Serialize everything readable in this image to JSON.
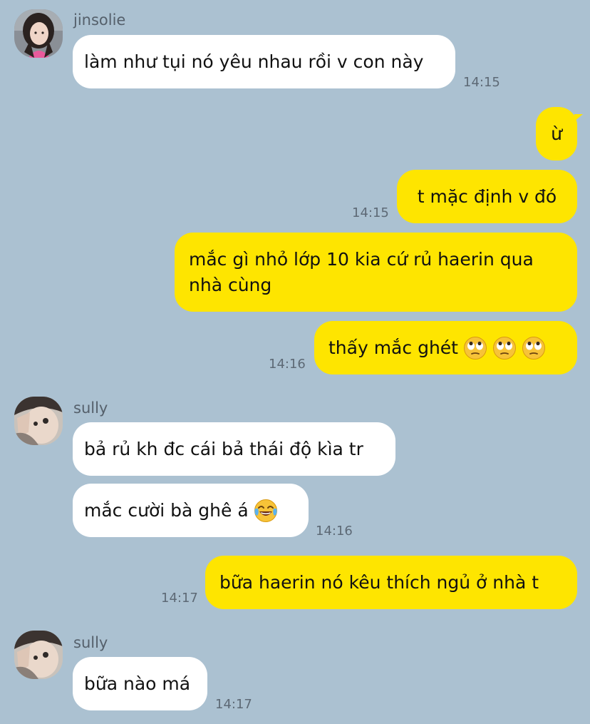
{
  "colors": {
    "background": "#abc1d1",
    "incoming_bubble": "#ffffff",
    "outgoing_bubble": "#fee500",
    "timestamp": "#5d6975"
  },
  "messages": [
    {
      "sender": "jinsolie",
      "text": "làm như tụi nó yêu nhau rồi v con này",
      "time": "14:15"
    },
    {
      "text": "ừ"
    },
    {
      "text": "t mặc định v đó",
      "time": "14:15"
    },
    {
      "text": "mắc gì nhỏ lớp 10 kia cứ rủ haerin qua nhà cùng"
    },
    {
      "text": "thấy mắc ghét",
      "emoji": [
        "face-with-rolling-eyes-icon",
        "face-with-rolling-eyes-icon",
        "face-with-rolling-eyes-icon"
      ],
      "time": "14:16"
    },
    {
      "sender": "sully",
      "text": "bả rủ kh đc cái bả thái độ kìa tr"
    },
    {
      "text": "mắc cười bà ghê á",
      "emoji": [
        "face-with-tears-of-joy-icon"
      ],
      "time": "14:16"
    },
    {
      "text": "bữa haerin nó kêu thích ngủ ở nhà t",
      "time": "14:17"
    },
    {
      "sender": "sully",
      "text": "bữa nào má",
      "time": "14:17"
    }
  ]
}
